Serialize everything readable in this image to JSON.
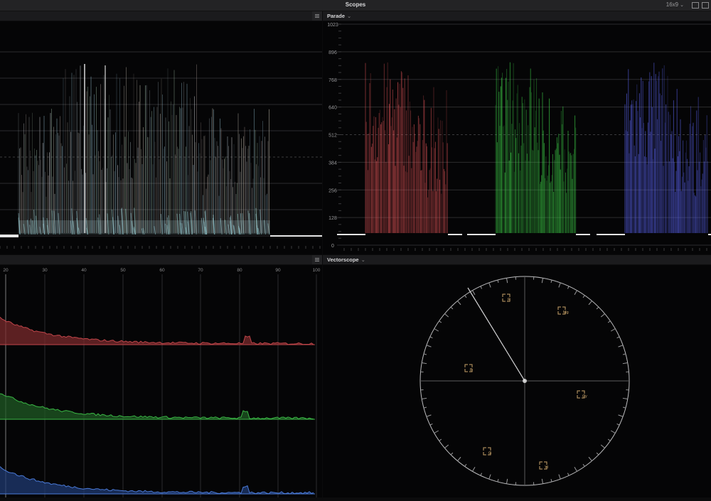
{
  "window": {
    "title": "Scopes",
    "aspect": "16x9"
  },
  "icons": {
    "aspect_chevron": "chevron-down-icon",
    "panel_menu": "menu-icon",
    "panel_chevron": "chevron-down-icon"
  },
  "parade": {
    "label": "Parade",
    "scale": [
      "1023",
      "896",
      "768",
      "640",
      "512",
      "384",
      "256",
      "128",
      "0"
    ],
    "colors": {
      "red": "#e8565a",
      "green": "#3fd64a",
      "blue": "#5a63f0"
    }
  },
  "histogram": {
    "scale": [
      "20",
      "30",
      "40",
      "50",
      "60",
      "70",
      "80",
      "90",
      "100"
    ],
    "colors": {
      "red": "#7a2a2c",
      "green": "#1f5a24",
      "blue": "#1f3a72"
    }
  },
  "vectorscope": {
    "label": "Vectorscope",
    "targets": [
      "R",
      "Mg",
      "B",
      "Cy",
      "G",
      "Yl"
    ]
  }
}
